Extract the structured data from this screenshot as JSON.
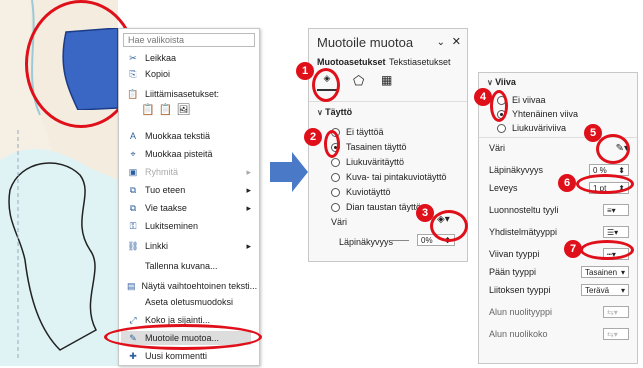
{
  "context_menu": {
    "search_placeholder": "Hae valikoista",
    "items": [
      {
        "label": "Leikkaa",
        "icon": "scissors-icon"
      },
      {
        "label": "Kopioi",
        "icon": "copy-icon"
      },
      {
        "label": "Liittämisasetukset:",
        "icon": "paste-icon"
      },
      {
        "label": "Muokkaa tekstiä",
        "icon": "edit-text-icon"
      },
      {
        "label": "Muokkaa pisteitä",
        "icon": "edit-points-icon"
      },
      {
        "label": "Ryhmitä",
        "icon": "group-icon"
      },
      {
        "label": "Tuo eteen",
        "icon": "bring-forward-icon"
      },
      {
        "label": "Vie taakse",
        "icon": "send-backward-icon"
      },
      {
        "label": "Lukitseminen",
        "icon": "lock-icon"
      },
      {
        "label": "Linkki",
        "icon": "link-icon"
      },
      {
        "label": "Tallenna kuvana...",
        "icon": ""
      },
      {
        "label": "Näytä vaihtoehtoinen teksti...",
        "icon": "alt-text-icon"
      },
      {
        "label": "Aseta oletusmuodoksi",
        "icon": ""
      },
      {
        "label": "Koko ja sijainti...",
        "icon": "size-icon"
      },
      {
        "label": "Muotoile muotoa...",
        "icon": "format-shape-icon"
      },
      {
        "label": "Uusi kommentti",
        "icon": "comment-icon"
      }
    ]
  },
  "format_pane": {
    "title": "Muotoile muotoa",
    "tab_shape": "Muotoasetukset",
    "tab_text": "Tekstiasetukset",
    "section_fill": "Täyttö",
    "fill_options": [
      "Ei täyttöä",
      "Tasainen täyttö",
      "Liukuväritäyttö",
      "Kuva- tai pintakuviotäyttö",
      "Kuviotäyttö",
      "Dian taustan täyttö"
    ],
    "color_label": "Väri",
    "transparency_label": "Läpinäkyvyys",
    "transparency_value": "0%"
  },
  "line_pane": {
    "section": "Viiva",
    "line_options": [
      "Ei viivaa",
      "Yhtenäinen viiva",
      "Liukuväriviiva"
    ],
    "color_label": "Väri",
    "transparency_label": "Läpinäkyvyys",
    "transparency_value": "0 %",
    "width_label": "Leveys",
    "width_value": "1 pt",
    "sketch_label": "Luonnosteltu tyyli",
    "compound_label": "Yhdistelmätyyppi",
    "dash_label": "Viivan tyyppi",
    "cap_label": "Pään tyyppi",
    "cap_value": "Tasainen",
    "join_label": "Liitoksen tyyppi",
    "join_value": "Terävä",
    "begin_arrow_label": "Alun nuolityyppi",
    "begin_size_label": "Alun nuolikoko"
  },
  "badges": [
    "1",
    "2",
    "3",
    "4",
    "5",
    "6",
    "7"
  ],
  "colors": {
    "accent": "#2f5f9e",
    "red": "#e0101a",
    "shape": "#3a66c4",
    "water": "#dff3f5"
  }
}
